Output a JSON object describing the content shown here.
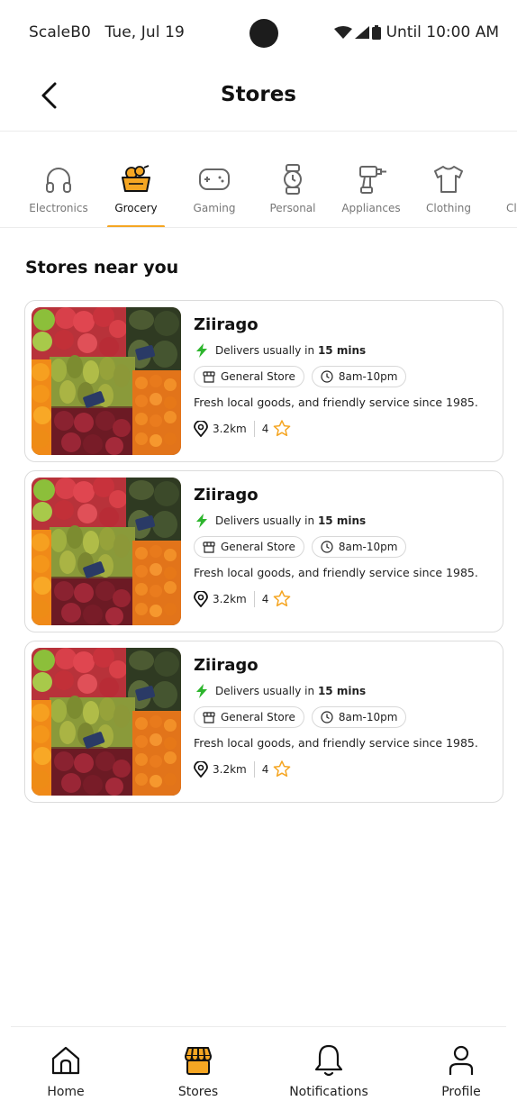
{
  "status_bar": {
    "carrier": "ScaleB0",
    "date": "Tue, Jul 19",
    "alarm": "Until 10:00 AM"
  },
  "header": {
    "title": "Stores"
  },
  "categories": [
    {
      "label": "Electronics",
      "icon": "headphones-icon",
      "active": false
    },
    {
      "label": "Grocery",
      "icon": "grocery-basket-icon",
      "active": true
    },
    {
      "label": "Gaming",
      "icon": "gamepad-icon",
      "active": false
    },
    {
      "label": "Personal",
      "icon": "watch-icon",
      "active": false
    },
    {
      "label": "Appliances",
      "icon": "drill-icon",
      "active": false
    },
    {
      "label": "Clothing",
      "icon": "tshirt-icon",
      "active": false
    },
    {
      "label": "Cl",
      "icon": "partial-category-icon",
      "active": false
    }
  ],
  "section_title": "Stores near you",
  "stores": [
    {
      "name": "Ziirago",
      "delivery_prefix": "Delivers usually in",
      "delivery_time": "15 mins",
      "type": "General Store",
      "hours": "8am-10pm",
      "description": "Fresh local goods, and friendly service since 1985.",
      "distance": "3.2km",
      "rating": "4"
    },
    {
      "name": "Ziirago",
      "delivery_prefix": "Delivers usually in",
      "delivery_time": "15 mins",
      "type": "General Store",
      "hours": "8am-10pm",
      "description": "Fresh local goods, and friendly service since 1985.",
      "distance": "3.2km",
      "rating": "4"
    },
    {
      "name": "Ziirago",
      "delivery_prefix": "Delivers usually in",
      "delivery_time": "15 mins",
      "type": "General Store",
      "hours": "8am-10pm",
      "description": "Fresh local goods, and friendly service since 1985.",
      "distance": "3.2km",
      "rating": "4"
    }
  ],
  "bottom_nav": [
    {
      "label": "Home",
      "icon": "home-icon",
      "active": false
    },
    {
      "label": "Stores",
      "icon": "store-icon",
      "active": true
    },
    {
      "label": "Notifications",
      "icon": "bell-icon",
      "active": false
    },
    {
      "label": "Profile",
      "icon": "user-icon",
      "active": false
    }
  ],
  "colors": {
    "accent": "#f5a623",
    "bolt": "#2db52d",
    "star": "#f5a623",
    "text": "#111111",
    "muted": "#777777"
  }
}
